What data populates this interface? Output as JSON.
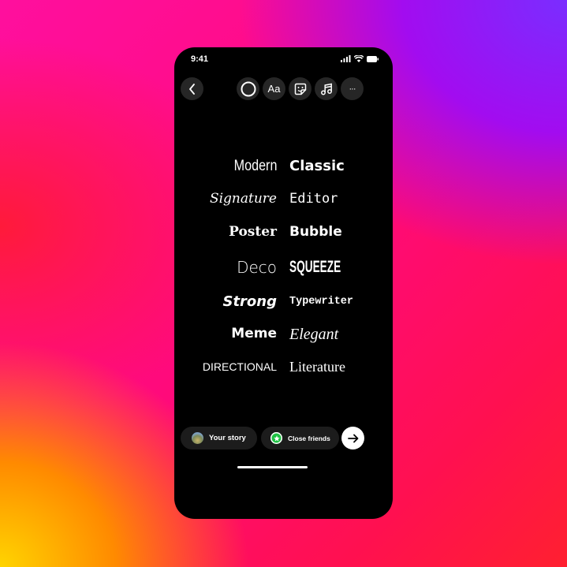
{
  "status_bar": {
    "time": "9:41",
    "signal_icon": "cellular-signal-icon",
    "wifi_icon": "wifi-icon",
    "battery_icon": "battery-icon"
  },
  "toolbar": {
    "back_icon": "chevron-left-icon",
    "buttons": [
      {
        "name": "color-circle",
        "icon": "circle-icon"
      },
      {
        "name": "text-style",
        "label": "Aa"
      },
      {
        "name": "sticker",
        "icon": "sticker-icon"
      },
      {
        "name": "music",
        "icon": "music-note-icon"
      },
      {
        "name": "more",
        "icon": "more-horizontal-icon",
        "label": "···"
      }
    ]
  },
  "fonts": {
    "rows": [
      {
        "left": "Modern",
        "right": "Classic"
      },
      {
        "left": "Signature",
        "right": "Editor"
      },
      {
        "left": "Poster",
        "right": "Bubble"
      },
      {
        "left": "Deco",
        "right": "SQUEEZE"
      },
      {
        "left": "Strong",
        "right": "Typewriter"
      },
      {
        "left": "Meme",
        "right": "Elegant"
      },
      {
        "left": "DIRECTIONAL",
        "right": "Literature"
      }
    ]
  },
  "share": {
    "your_story": "Your story",
    "close_friends": "Close friends",
    "close_friends_color": "#1ec243",
    "send_icon": "arrow-right-icon"
  }
}
